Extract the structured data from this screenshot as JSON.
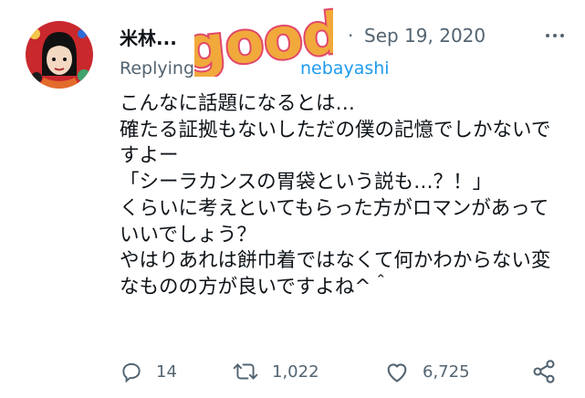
{
  "tweet": {
    "author_name": "米林...",
    "sticker_text": "good",
    "date": "Sep 19, 2020",
    "separator": "·",
    "replying_prefix": "Replying",
    "replying_handle_tail": "nebayashi",
    "body": "こんなに話題になるとは…\n確たる証拠もないしただの僕の記憶でしかないですよー\n「シーラカンスの胃袋という説も…？！」\nくらいに考えといてもらった方がロマンがあっていいでしょう？\nやはりあれは餅巾着ではなくて何かわからない変なものの方が良いですよね^＾",
    "reply_count": "14",
    "retweet_count": "1,022",
    "like_count": "6,725"
  },
  "icons": {
    "avatar": "profile-avatar",
    "more": "more-icon",
    "reply": "reply-icon",
    "retweet": "retweet-icon",
    "like": "heart-icon",
    "share": "share-icon"
  },
  "colors": {
    "text_primary": "#0f1419",
    "text_secondary": "#536471",
    "link": "#1d9bf0",
    "sticker_fill": "#f1a93b",
    "sticker_outline": "#e2486a"
  }
}
